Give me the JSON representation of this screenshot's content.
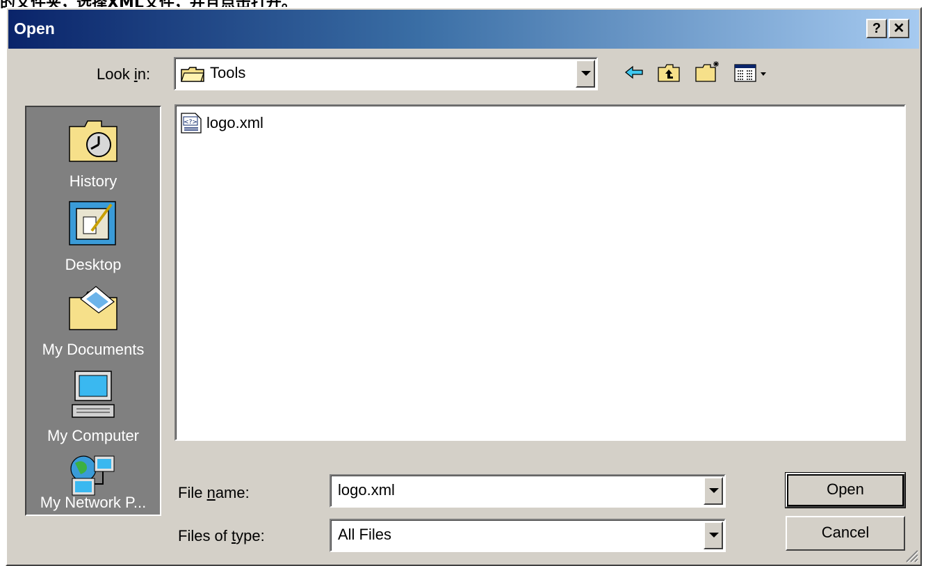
{
  "caption": "的文件夹，选择XML文件，并且点击打开。",
  "window": {
    "title": "Open",
    "help_button": "?",
    "close_button": "✕"
  },
  "look_in": {
    "label": "Look in:",
    "value": "Tools"
  },
  "toolbar": {
    "icons": [
      "back-arrow-icon",
      "up-one-level-icon",
      "create-new-folder-icon",
      "view-menu-icon"
    ]
  },
  "places": [
    {
      "label": "History",
      "icon": "history-icon"
    },
    {
      "label": "Desktop",
      "icon": "desktop-icon"
    },
    {
      "label": "My Documents",
      "icon": "my-documents-icon"
    },
    {
      "label": "My Computer",
      "icon": "my-computer-icon"
    },
    {
      "label": "My Network P...",
      "icon": "my-network-places-icon"
    }
  ],
  "files": [
    {
      "name": "logo.xml",
      "icon": "xml-file-icon"
    }
  ],
  "file_name": {
    "label": "File name:",
    "value": "logo.xml"
  },
  "file_type": {
    "label": "Files of type:",
    "value": "All Files"
  },
  "buttons": {
    "open": "Open",
    "cancel": "Cancel"
  }
}
